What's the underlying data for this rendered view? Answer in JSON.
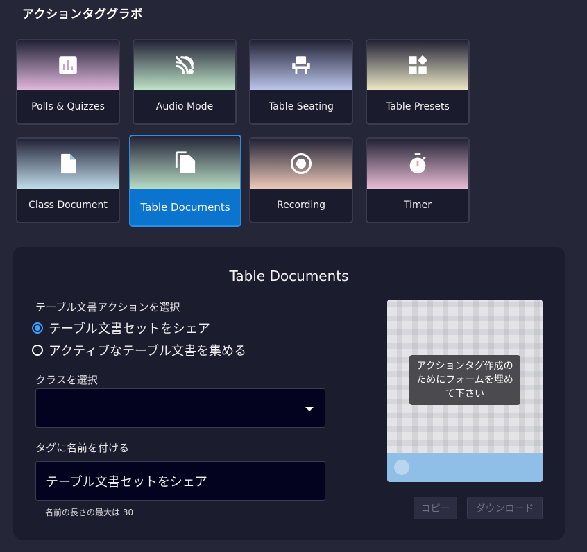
{
  "header": {
    "title": "アクションタググラボ"
  },
  "tiles": [
    {
      "label": "Polls & Quizzes",
      "icon": "poll-icon",
      "gradient": [
        "#222236",
        "#e2b8dc"
      ]
    },
    {
      "label": "Audio Mode",
      "icon": "audio-waves-icon",
      "gradient": [
        "#222236",
        "#bfe3c8"
      ]
    },
    {
      "label": "Table Seating",
      "icon": "chair-icon",
      "gradient": [
        "#222236",
        "#bcc6ec"
      ]
    },
    {
      "label": "Table Presets",
      "icon": "widgets-icon",
      "gradient": [
        "#222236",
        "#ece8c6"
      ]
    },
    {
      "label": "Class Document",
      "icon": "document-icon",
      "gradient": [
        "#222236",
        "#bfdcea"
      ]
    },
    {
      "label": "Table Documents",
      "icon": "documents-icon",
      "gradient": [
        "#222236",
        "#b7dcc4"
      ],
      "selected": true
    },
    {
      "label": "Recording",
      "icon": "record-icon",
      "gradient": [
        "#222236",
        "#ecc9b8"
      ]
    },
    {
      "label": "Timer",
      "icon": "timer-icon",
      "gradient": [
        "#222236",
        "#e8bcd4"
      ]
    }
  ],
  "panel": {
    "title": "Table Documents",
    "action_label": "テーブル文書アクションを選択",
    "options": [
      {
        "label": "テーブル文書セットをシェア",
        "checked": true
      },
      {
        "label": "アクティブなテーブル文書を集める",
        "checked": false
      }
    ],
    "class_label": "クラスを選択",
    "class_value": "",
    "tag_label": "タグに名前を付ける",
    "tag_value": "テーブル文書セットをシェア",
    "hint": "名前の長さの最大は 30",
    "qr_overlay": "アクションタグ作成のためにフォームを埋めて下さい",
    "copy_button": "コピー",
    "download_button": "ダウンロード"
  },
  "colors": {
    "background": "#262639",
    "panel": "#1c1c2f",
    "selected": "#0a74cf",
    "radio": "#3ea0ff"
  }
}
